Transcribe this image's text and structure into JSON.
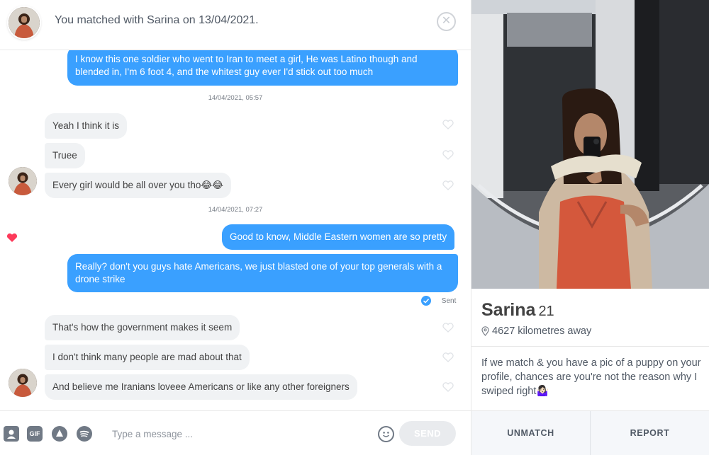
{
  "header": {
    "match_text": "You matched with Sarina on 13/04/2021.",
    "close_icon": "close-icon"
  },
  "messages": [
    {
      "type": "out",
      "text": "I know this one soldier who went to Iran to meet a girl, He was Latino though and blended in, I'm 6 foot 4, and the whitest guy ever I'd stick out too much"
    },
    {
      "type": "stamp",
      "text": "14/04/2021, 05:57"
    },
    {
      "type": "in",
      "text": "Yeah I think it is",
      "liked": false
    },
    {
      "type": "in",
      "text": "Truee",
      "liked": false
    },
    {
      "type": "in",
      "text": "Every girl would be all over you tho😂😂",
      "liked": false
    },
    {
      "type": "stamp",
      "text": "14/04/2021, 07:27"
    },
    {
      "type": "out",
      "text": "Good to know, Middle Eastern women are so pretty",
      "liked": true
    },
    {
      "type": "out",
      "text": "Really? don't you guys hate Americans, we just blasted one of your top generals with a drone strike"
    },
    {
      "type": "status",
      "text": "Sent"
    },
    {
      "type": "in",
      "text": "That's how the government makes it seem",
      "liked": false
    },
    {
      "type": "in",
      "text": "I don't think many people are mad about that",
      "liked": false
    },
    {
      "type": "in",
      "text": "And believe me Iranians loveee Americans or like any other foreigners",
      "liked": false
    }
  ],
  "composer": {
    "placeholder": "Type a message ...",
    "gif_label": "GIF",
    "send_label": "SEND"
  },
  "profile": {
    "name": "Sarina",
    "age": "21",
    "distance": "4627 kilometres away",
    "bio": "If we match & you have a pic of a puppy on your profile, chances are you're not the reason why I swiped right🤷🏻‍♀️",
    "unmatch_label": "UNMATCH",
    "report_label": "REPORT"
  },
  "colors": {
    "outgoing_bubble": "#3aa0ff",
    "incoming_bubble": "#f0f2f4",
    "like_heart": "#fd3a5a"
  }
}
